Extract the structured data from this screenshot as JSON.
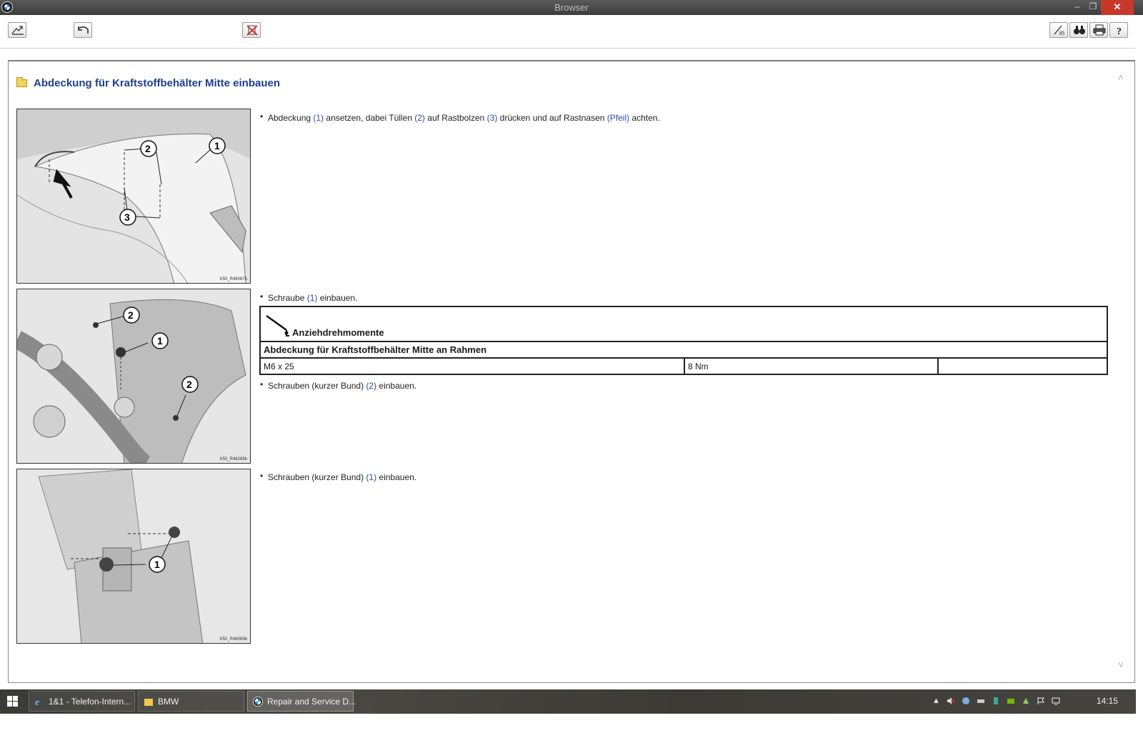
{
  "window": {
    "title": "Browser",
    "minimize": "–",
    "maximize": "❐",
    "close": "✕"
  },
  "toolbar": {
    "left": [
      {
        "name": "home-icon"
      },
      {
        "name": "back-icon"
      },
      {
        "name": "clear-icon"
      }
    ],
    "right": [
      {
        "name": "login-icon"
      },
      {
        "name": "search-icon"
      },
      {
        "name": "print-icon"
      },
      {
        "name": "help-icon"
      }
    ]
  },
  "page": {
    "title": "Abdeckung für Kraftstoffbehälter Mitte einbauen",
    "figures": [
      {
        "code": "K50_R46067b",
        "callouts": [
          "1",
          "2",
          "3"
        ]
      },
      {
        "code": "K50_R46068b",
        "callouts": [
          "1",
          "2",
          "2"
        ]
      },
      {
        "code": "K50_R46069b",
        "callouts": [
          "1"
        ]
      }
    ],
    "steps": [
      {
        "bullet": "•",
        "parts": [
          "Abdeckung ",
          "(1)",
          " ansetzen, dabei Tüllen ",
          "(2)",
          " auf Rastbolzen ",
          "(3)",
          " drücken und auf Rastnasen ",
          "(Pfeil)",
          " achten."
        ]
      },
      {
        "bullet": "•",
        "parts": [
          "Schraube ",
          "(1)",
          " einbauen."
        ]
      },
      {
        "bullet": "•",
        "parts": [
          "Schrauben (kurzer Bund) ",
          "(2)",
          " einbauen."
        ]
      },
      {
        "bullet": "•",
        "parts": [
          "Schrauben (kurzer Bund) ",
          "(1)",
          " einbauen."
        ]
      }
    ],
    "torque_table": {
      "heading": "Anziehdrehmomente",
      "subheading": "Abdeckung für Kraftstoffbehälter Mitte an Rahmen",
      "row": [
        "M6 x 25",
        "8 Nm",
        ""
      ]
    },
    "scroll": {
      "up": "˄",
      "down": "˅"
    }
  },
  "taskbar": {
    "items": [
      {
        "label": "1&1 - Telefon-Intern...",
        "icon": "ie-icon"
      },
      {
        "label": "BMW",
        "icon": "folder-icon"
      },
      {
        "label": "Repair and Service D...",
        "icon": "bmw-icon"
      }
    ],
    "tray_arrow": "▲",
    "clock": "14:15"
  },
  "colors": {
    "title_blue": "#1d3e91",
    "ref_blue": "#2b4aa8",
    "close_red": "#c7382b"
  }
}
